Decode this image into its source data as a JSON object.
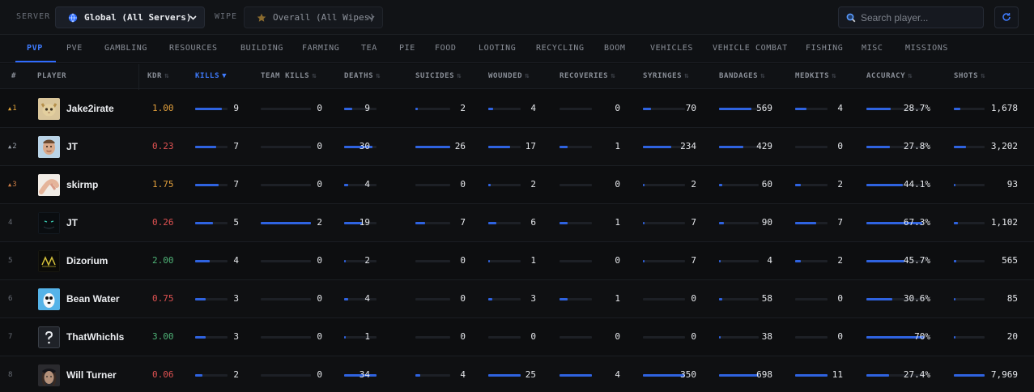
{
  "filters": {
    "server_label": "SERVER",
    "server_value": "Global (All Servers)",
    "wipe_label": "WIPE",
    "wipe_value": "Overall (All Wipes)",
    "search_placeholder": "Search player..."
  },
  "colors": {
    "accent": "#2f6bff",
    "kdr_good": "#e3a03c",
    "kdr_bad": "#e05252",
    "kdr_great": "#4fb377"
  },
  "tabs": [
    "PVP",
    "PVE",
    "GAMBLING",
    "RESOURCES",
    "BUILDING",
    "FARMING",
    "TEA",
    "PIE",
    "FOOD",
    "LOOTING",
    "RECYCLING",
    "BOOM",
    "VEHICLES",
    "VEHICLE COMBAT",
    "FISHING",
    "MISC",
    "MISSIONS"
  ],
  "active_tab": "PVP",
  "columns": {
    "rank": "#",
    "player": "PLAYER",
    "kdr": "KDR",
    "kills": "KILLS",
    "team_kills": "TEAM KILLS",
    "deaths": "DEATHS",
    "suicides": "SUICIDES",
    "wounded": "WOUNDED",
    "recoveries": "RECOVERIES",
    "syringes": "SYRINGES",
    "bandages": "BANDAGES",
    "medkits": "MEDKITS",
    "accuracy": "ACCURACY",
    "shots": "SHOTS"
  },
  "sort_icon": "⇅",
  "sort_active_icon": "▼",
  "rows": [
    {
      "rank": "1",
      "rank_icon": "▲",
      "name": "Jake2irate",
      "avatar": "cat-avatar",
      "kdr": "1.00",
      "kdr_tone": "good",
      "kills": "9",
      "team_kills": "0",
      "deaths": "9",
      "suicides": "2",
      "wounded": "4",
      "recoveries": "0",
      "syringes": "70",
      "bandages": "569",
      "medkits": "4",
      "accuracy": "28.7%",
      "shots": "1,678",
      "fractions": {
        "kills": 0.83,
        "team_kills": 0,
        "deaths": 0.26,
        "suicides": 0.08,
        "wounded": 0.16,
        "recoveries": 0,
        "syringes": 0.2,
        "bandages": 0.82,
        "medkits": 0.36,
        "accuracy": 0.41,
        "shots": 0.21
      }
    },
    {
      "rank": "2",
      "rank_icon": "▲",
      "name": "JT",
      "avatar": "person-avatar",
      "kdr": "0.23",
      "kdr_tone": "bad",
      "kills": "7",
      "team_kills": "0",
      "deaths": "30",
      "suicides": "26",
      "wounded": "17",
      "recoveries": "1",
      "syringes": "234",
      "bandages": "429",
      "medkits": "0",
      "accuracy": "27.8%",
      "shots": "3,202",
      "fractions": {
        "kills": 0.65,
        "team_kills": 0,
        "deaths": 0.88,
        "suicides": 1.0,
        "wounded": 0.68,
        "recoveries": 0.25,
        "syringes": 0.67,
        "bandages": 0.61,
        "medkits": 0,
        "accuracy": 0.4,
        "shots": 0.4
      }
    },
    {
      "rank": "3",
      "rank_icon": "▲",
      "name": "skirmp",
      "avatar": "arm-avatar",
      "kdr": "1.75",
      "kdr_tone": "good",
      "kills": "7",
      "team_kills": "0",
      "deaths": "4",
      "suicides": "0",
      "wounded": "2",
      "recoveries": "0",
      "syringes": "2",
      "bandages": "60",
      "medkits": "2",
      "accuracy": "44.1%",
      "shots": "93",
      "fractions": {
        "kills": 0.72,
        "team_kills": 0,
        "deaths": 0.12,
        "suicides": 0,
        "wounded": 0.08,
        "recoveries": 0,
        "syringes": 0.01,
        "bandages": 0.09,
        "medkits": 0.18,
        "accuracy": 0.63,
        "shots": 0.01
      }
    },
    {
      "rank": "4",
      "rank_icon": "",
      "name": "JT",
      "avatar": "dark-face-avatar",
      "kdr": "0.26",
      "kdr_tone": "bad",
      "kills": "5",
      "team_kills": "2",
      "deaths": "19",
      "suicides": "7",
      "wounded": "6",
      "recoveries": "1",
      "syringes": "7",
      "bandages": "90",
      "medkits": "7",
      "accuracy": "67.3%",
      "shots": "1,102",
      "fractions": {
        "kills": 0.56,
        "team_kills": 1.0,
        "deaths": 0.56,
        "suicides": 0.27,
        "wounded": 0.24,
        "recoveries": 0.25,
        "syringes": 0.02,
        "bandages": 0.13,
        "medkits": 0.64,
        "accuracy": 0.96,
        "shots": 0.14
      }
    },
    {
      "rank": "5",
      "rank_icon": "",
      "name": "Dizorium",
      "avatar": "logo-avatar",
      "kdr": "2.00",
      "kdr_tone": "great",
      "kills": "4",
      "team_kills": "0",
      "deaths": "2",
      "suicides": "0",
      "wounded": "1",
      "recoveries": "0",
      "syringes": "7",
      "bandages": "4",
      "medkits": "2",
      "accuracy": "45.7%",
      "shots": "565",
      "fractions": {
        "kills": 0.44,
        "team_kills": 0,
        "deaths": 0.06,
        "suicides": 0,
        "wounded": 0.04,
        "recoveries": 0,
        "syringes": 0.02,
        "bandages": 0.01,
        "medkits": 0.18,
        "accuracy": 0.65,
        "shots": 0.07
      }
    },
    {
      "rank": "6",
      "rank_icon": "",
      "name": "Bean Water",
      "avatar": "bean-avatar",
      "kdr": "0.75",
      "kdr_tone": "bad",
      "kills": "3",
      "team_kills": "0",
      "deaths": "4",
      "suicides": "0",
      "wounded": "3",
      "recoveries": "1",
      "syringes": "0",
      "bandages": "58",
      "medkits": "0",
      "accuracy": "30.6%",
      "shots": "85",
      "fractions": {
        "kills": 0.33,
        "team_kills": 0,
        "deaths": 0.12,
        "suicides": 0,
        "wounded": 0.12,
        "recoveries": 0.25,
        "syringes": 0,
        "bandages": 0.08,
        "medkits": 0,
        "accuracy": 0.44,
        "shots": 0.01
      }
    },
    {
      "rank": "7",
      "rank_icon": "",
      "name": "ThatWhichIs",
      "avatar": "question-avatar",
      "kdr": "3.00",
      "kdr_tone": "great",
      "kills": "3",
      "team_kills": "0",
      "deaths": "1",
      "suicides": "0",
      "wounded": "0",
      "recoveries": "0",
      "syringes": "0",
      "bandages": "38",
      "medkits": "0",
      "accuracy": "70%",
      "shots": "20",
      "fractions": {
        "kills": 0.33,
        "team_kills": 0,
        "deaths": 0.03,
        "suicides": 0,
        "wounded": 0,
        "recoveries": 0,
        "syringes": 0,
        "bandages": 0.05,
        "medkits": 0,
        "accuracy": 1.0,
        "shots": 0.01
      }
    },
    {
      "rank": "8",
      "rank_icon": "",
      "name": "Will Turner",
      "avatar": "pirate-avatar",
      "kdr": "0.06",
      "kdr_tone": "bad",
      "kills": "2",
      "team_kills": "0",
      "deaths": "34",
      "suicides": "4",
      "wounded": "25",
      "recoveries": "4",
      "syringes": "350",
      "bandages": "698",
      "medkits": "11",
      "accuracy": "27.4%",
      "shots": "7,969",
      "fractions": {
        "kills": 0.22,
        "team_kills": 0,
        "deaths": 1.0,
        "suicides": 0.15,
        "wounded": 1.0,
        "recoveries": 1.0,
        "syringes": 1.0,
        "bandages": 1.0,
        "medkits": 1.0,
        "accuracy": 0.39,
        "shots": 1.0
      }
    }
  ]
}
